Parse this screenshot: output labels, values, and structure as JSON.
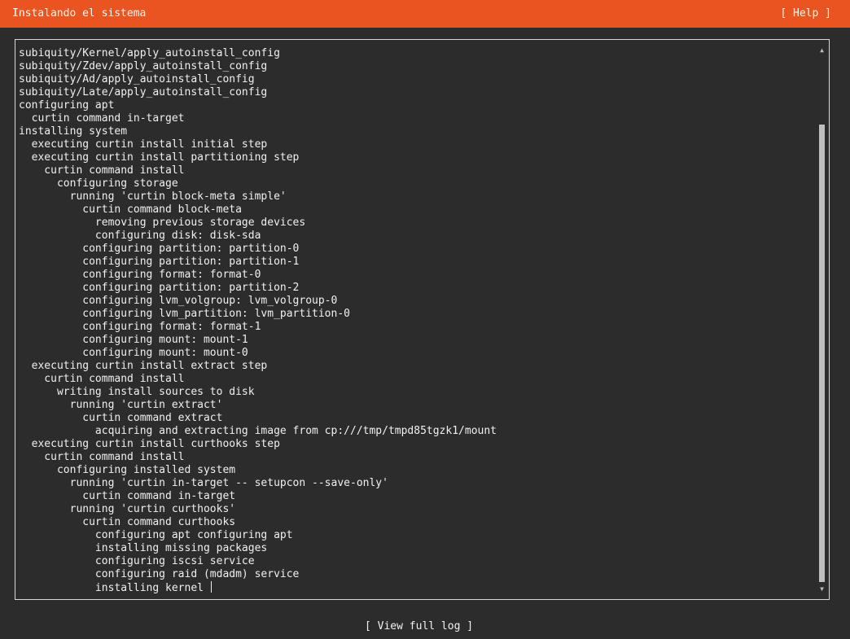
{
  "header": {
    "title": "Instalando el sistema",
    "help_label": "[ Help ]",
    "accent_color": "#e95420"
  },
  "log": {
    "lines": [
      "subiquity/Kernel/apply_autoinstall_config",
      "subiquity/Zdev/apply_autoinstall_config",
      "subiquity/Ad/apply_autoinstall_config",
      "subiquity/Late/apply_autoinstall_config",
      "configuring apt",
      "  curtin command in-target",
      "installing system",
      "  executing curtin install initial step",
      "  executing curtin install partitioning step",
      "    curtin command install",
      "      configuring storage",
      "        running 'curtin block-meta simple'",
      "          curtin command block-meta",
      "            removing previous storage devices",
      "            configuring disk: disk-sda",
      "          configuring partition: partition-0",
      "          configuring partition: partition-1",
      "          configuring format: format-0",
      "          configuring partition: partition-2",
      "          configuring lvm_volgroup: lvm_volgroup-0",
      "          configuring lvm_partition: lvm_partition-0",
      "          configuring format: format-1",
      "          configuring mount: mount-1",
      "          configuring mount: mount-0",
      "  executing curtin install extract step",
      "    curtin command install",
      "      writing install sources to disk",
      "        running 'curtin extract'",
      "          curtin command extract",
      "            acquiring and extracting image from cp:///tmp/tmpd85tgzk1/mount",
      "  executing curtin install curthooks step",
      "    curtin command install",
      "      configuring installed system",
      "        running 'curtin in-target -- setupcon --save-only'",
      "          curtin command in-target",
      "        running 'curtin curthooks'",
      "          curtin command curthooks",
      "            configuring apt configuring apt",
      "            installing missing packages",
      "            configuring iscsi service",
      "            configuring raid (mdadm) service",
      "            installing kernel"
    ],
    "scroll_up_icon": "triangle-up",
    "scroll_down_icon": "triangle-down"
  },
  "footer": {
    "view_log_label": "[ View full log ]"
  }
}
